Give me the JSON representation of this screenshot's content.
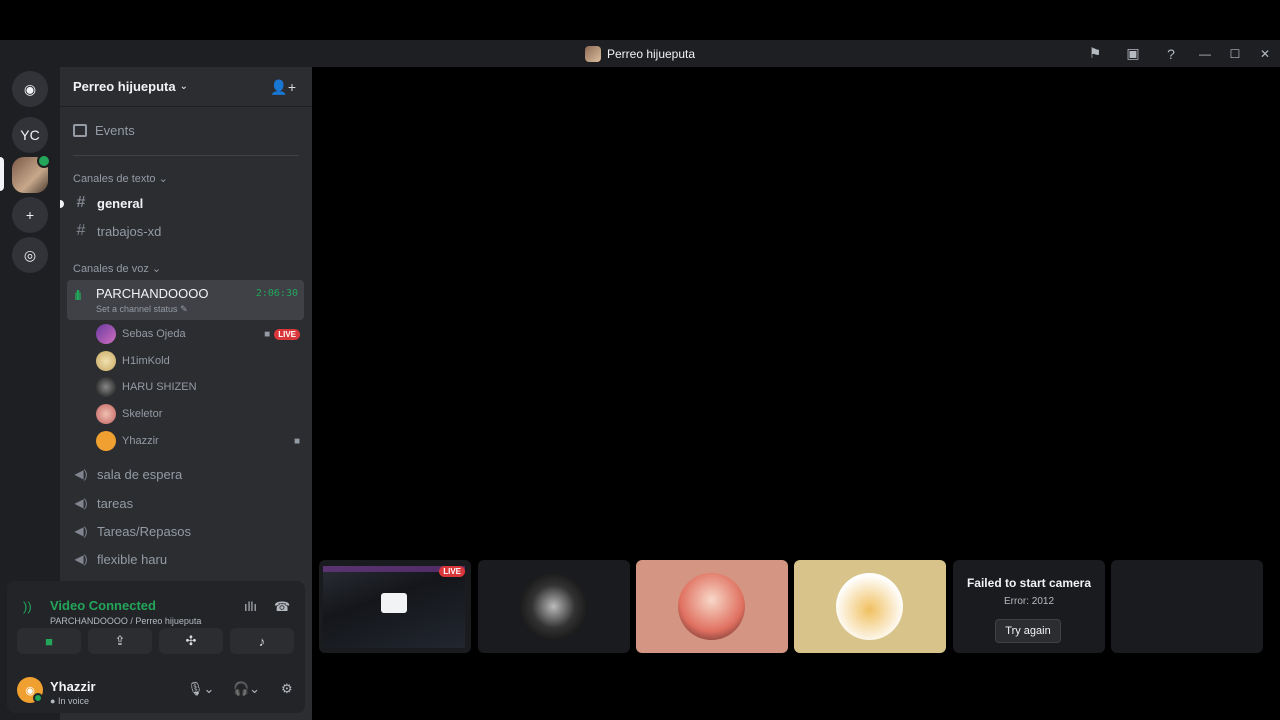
{
  "window": {
    "title": "Perreo hijueputa"
  },
  "titlebar_icons": [
    "flag-icon",
    "screen-share-icon",
    "help-icon",
    "minimize-icon",
    "maximize-icon",
    "close-icon"
  ],
  "guilds": {
    "home": "discord-logo",
    "yc_label": "YC"
  },
  "server": {
    "name": "Perreo hijueputa",
    "events_label": "Events"
  },
  "categories": {
    "text": "Canales de texto",
    "voice": "Canales de voz"
  },
  "text_channels": [
    {
      "name": "general"
    },
    {
      "name": "trabajos-xd"
    }
  ],
  "active_voice": {
    "name": "PARCHANDOOOO",
    "status": "Set a channel status",
    "timer": "2:06:30"
  },
  "voice_users": [
    {
      "name": "Sebas Ojeda",
      "live": "LIVE"
    },
    {
      "name": "H1imKold"
    },
    {
      "name": "HARU SHIZEN"
    },
    {
      "name": "Skeletor"
    },
    {
      "name": "Yhazzir"
    }
  ],
  "voice_channels": [
    {
      "name": "sala de espera"
    },
    {
      "name": "tareas"
    },
    {
      "name": "Tareas/Repasos"
    },
    {
      "name": "flexible haru"
    }
  ],
  "voice_panel": {
    "title": "Video Connected",
    "subtitle": "PARCHANDOOOO / Perreo hijueputa"
  },
  "user": {
    "name": "Yhazzir",
    "status": "In voice"
  },
  "tiles": {
    "live": "LIVE",
    "fail_title": "Failed to start camera",
    "fail_error": "Error: 2012",
    "retry_label": "Try again"
  },
  "colors": {
    "accent_green": "#23a55a",
    "live_red": "#da373c",
    "bg": "#2b2d31"
  }
}
